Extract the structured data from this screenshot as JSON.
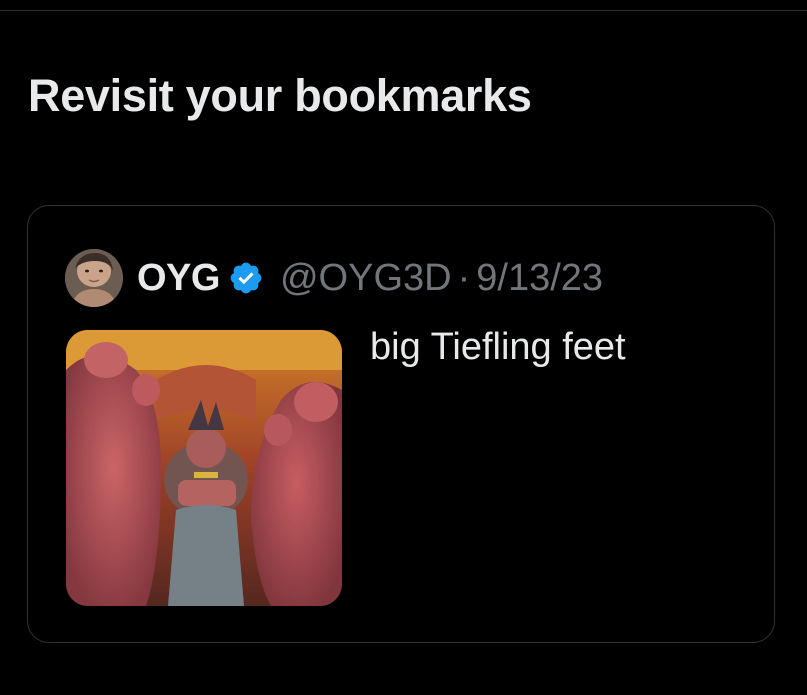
{
  "section": {
    "title": "Revisit your bookmarks"
  },
  "tweet": {
    "display_name": "OYG",
    "verified": true,
    "handle": "@OYG3D",
    "separator": "·",
    "date": "9/13/23",
    "text": "big Tiefling feet",
    "avatar_icon": "user-avatar",
    "media_icon": "image-thumbnail"
  },
  "colors": {
    "background": "#000000",
    "primary_text": "#e7e9ea",
    "secondary_text": "#71767b",
    "border": "#2f3336",
    "verified_blue": "#1d9bf0"
  }
}
